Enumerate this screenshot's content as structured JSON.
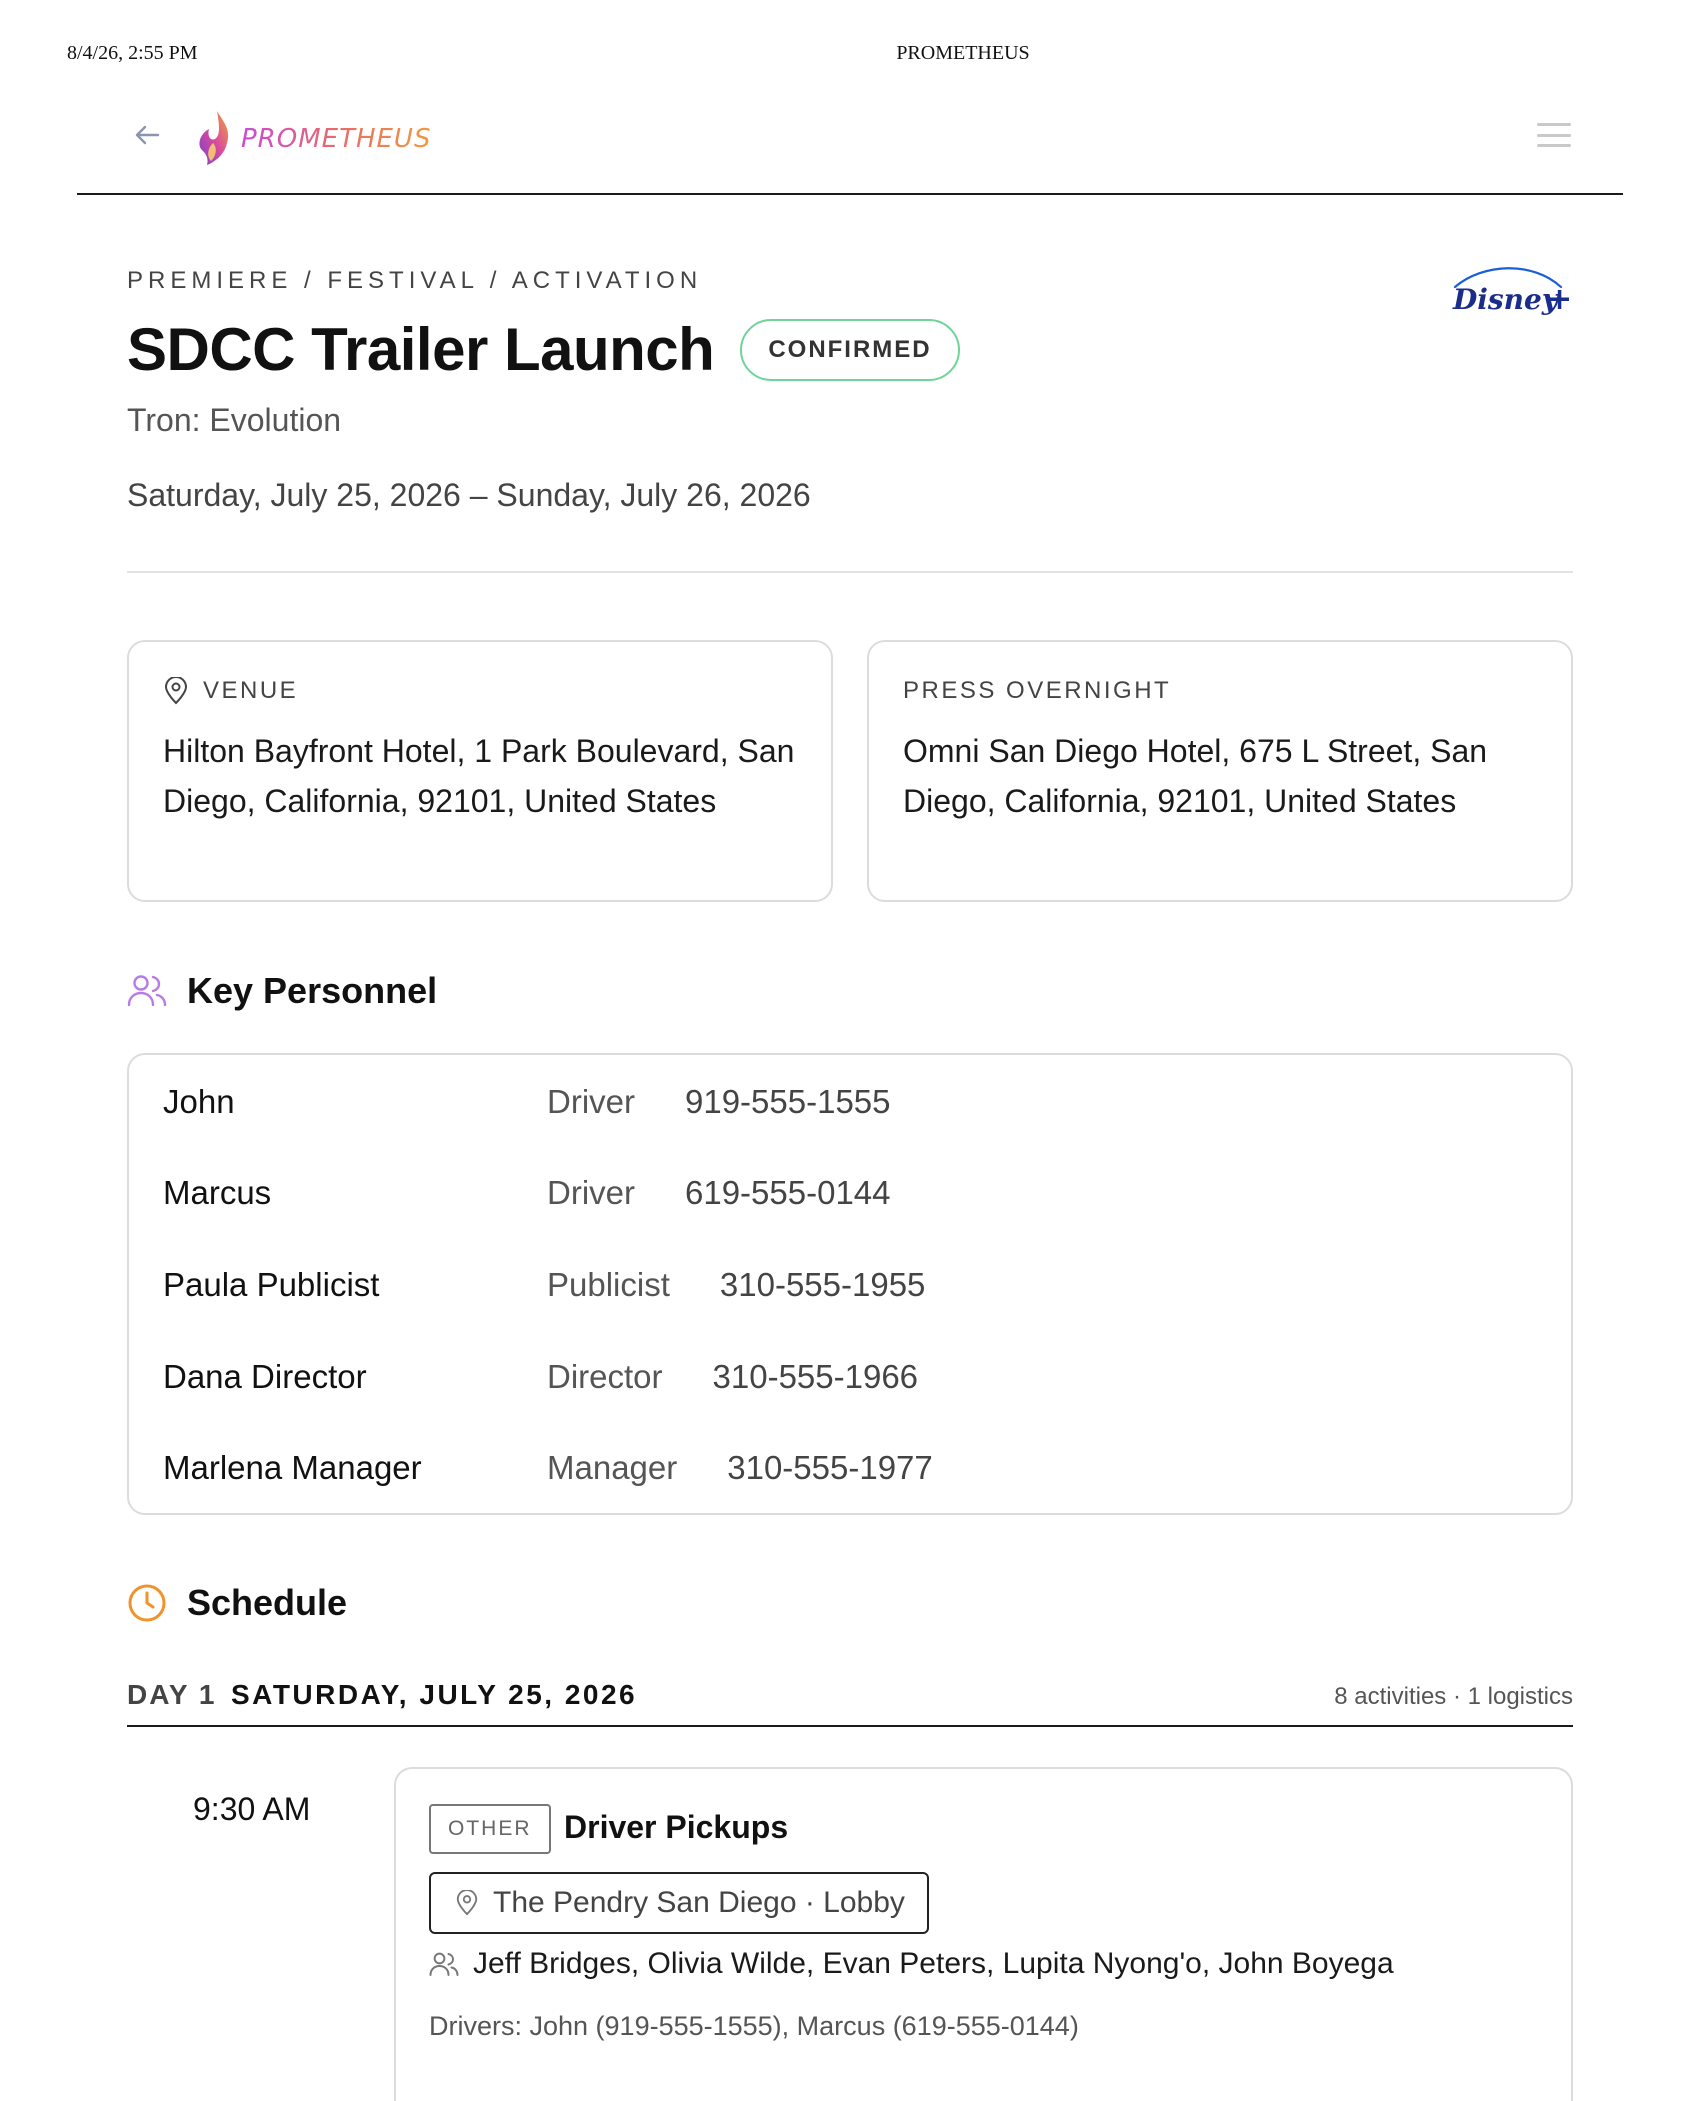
{
  "print_header": {
    "datetime": "8/4/26, 2:55 PM",
    "title": "PROMETHEUS"
  },
  "app_bar": {
    "logo_text": "PROMETHEUS",
    "icons": [
      "back-arrow-icon",
      "menu-icon"
    ]
  },
  "event": {
    "category": "PREMIERE / FESTIVAL / ACTIVATION",
    "title": "SDCC Trailer Launch",
    "status": "CONFIRMED",
    "subtitle": "Tron: Evolution",
    "dates": "Saturday, July 25, 2026 – Sunday, July 26, 2026",
    "studio_logo": "Disney+"
  },
  "venue": {
    "label": "VENUE",
    "address": "Hilton Bayfront Hotel, 1 Park Boulevard, San Diego, California, 92101, United States"
  },
  "press_overnight": {
    "label": "PRESS OVERNIGHT",
    "address": "Omni San Diego Hotel, 675 L Street, San Diego, California, 92101, United States"
  },
  "personnel": {
    "heading": "Key Personnel",
    "people": [
      {
        "name": "John",
        "role": "Driver",
        "phone": "919-555-1555"
      },
      {
        "name": "Marcus",
        "role": "Driver",
        "phone": "619-555-0144"
      },
      {
        "name": "Paula Publicist",
        "role": "Publicist",
        "phone": "310-555-1955"
      },
      {
        "name": "Dana Director",
        "role": "Director",
        "phone": "310-555-1966"
      },
      {
        "name": "Marlena Manager",
        "role": "Manager",
        "phone": "310-555-1977"
      }
    ]
  },
  "schedule": {
    "heading": "Schedule",
    "days": [
      {
        "day_label": "DAY 1",
        "date": "SATURDAY, JULY 25, 2026",
        "summary": "8 activities · 1 logistics",
        "activities": [
          {
            "time": "9:30 AM",
            "type": "OTHER",
            "title": "Driver Pickups",
            "location": "The Pendry San Diego · Lobby",
            "talent": "Jeff Bridges, Olivia Wilde, Evan Peters, Lupita Nyong'o, John Boyega",
            "notes": "Drivers: John (919-555-1555), Marcus (619-555-0144)"
          }
        ]
      }
    ]
  },
  "colors": {
    "status_border": "#6fd39a",
    "personnel_icon": "#b77be6",
    "schedule_icon": "#f0932b",
    "logo_gradient_start": "#c84bd8",
    "logo_gradient_end": "#f19a3e"
  }
}
